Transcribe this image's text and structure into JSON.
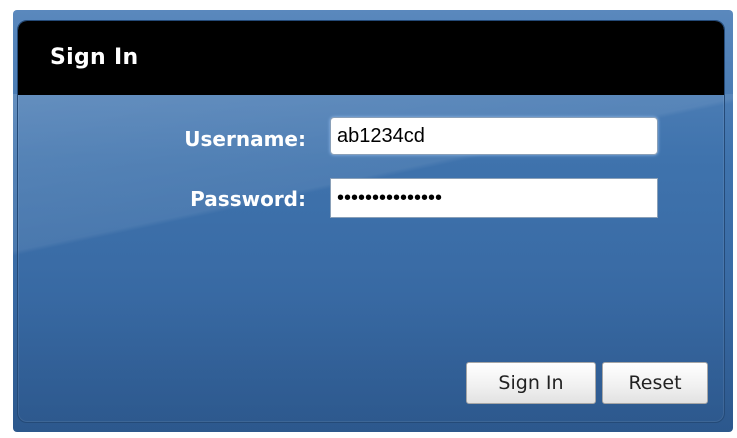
{
  "dialog": {
    "title": "Sign In"
  },
  "form": {
    "username": {
      "label": "Username:",
      "value": "ab1234cd"
    },
    "password": {
      "label": "Password:",
      "value": "•••••••••••••••"
    }
  },
  "buttons": {
    "sign_in_label": "Sign In",
    "reset_label": "Reset"
  },
  "colors": {
    "panel_blue": "#3f73ad",
    "header_black": "#000000",
    "label_white": "#ffffff"
  }
}
